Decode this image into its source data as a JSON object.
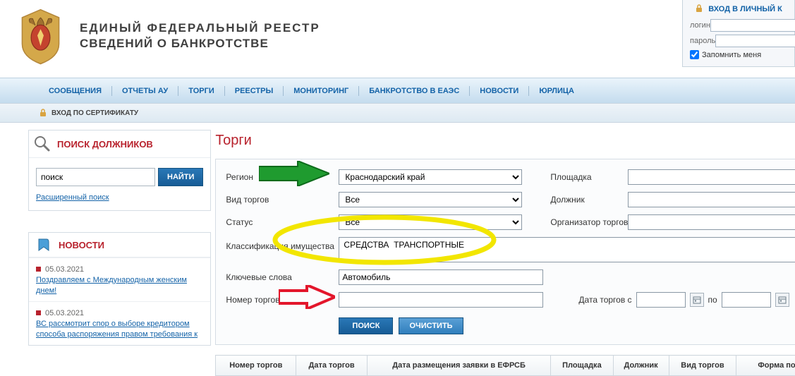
{
  "header": {
    "title_line1": "ЕДИНЫЙ  ФЕДЕРАЛЬНЫЙ  РЕЕСТР",
    "title_line2": "СВЕДЕНИЙ О БАНКРОТСТВЕ"
  },
  "login": {
    "panel_title": "ВХОД В ЛИЧНЫЙ К",
    "login_label": "логин",
    "password_label": "пароль",
    "remember_label": "Запомнить меня"
  },
  "nav": {
    "items": [
      "СООБЩЕНИЯ",
      "ОТЧЕТЫ АУ",
      "ТОРГИ",
      "РЕЕСТРЫ",
      "МОНИТОРИНГ",
      "БАНКРОТСТВО В ЕАЭС",
      "НОВОСТИ",
      "ЮРЛИЦА"
    ]
  },
  "cert": {
    "label": "ВХОД ПО СЕРТИФИКАТУ"
  },
  "debtor_search": {
    "heading": "ПОИСК ДОЛЖНИКОВ",
    "input_value": "поиск",
    "button_label": "НАЙТИ",
    "extended_link": "Расширенный поиск"
  },
  "news_block": {
    "heading": "НОВОСТИ",
    "items": [
      {
        "date": "05.03.2021",
        "title": "Поздравляем с Международным женским днем!"
      },
      {
        "date": "05.03.2021",
        "title": "ВС рассмотрит спор о выборе кредитором способа распоряжения правом требования к"
      }
    ]
  },
  "torgi": {
    "page_title": "Торги",
    "labels": {
      "region": "Регион",
      "type": "Вид торгов",
      "status": "Статус",
      "classification": "Классификация имущества",
      "keywords": "Ключевые слова",
      "number": "Номер торгов",
      "platform": "Площадка",
      "debtor": "Должник",
      "organizer": "Организатор торгов",
      "date_from": "Дата торгов  с",
      "date_to": "по"
    },
    "values": {
      "region": "Краснодарский край",
      "type": "Все",
      "status": "Все",
      "classification": "СРЕДСТВА  ТРАНСПОРТНЫЕ",
      "keywords": "Автомобиль",
      "number": "",
      "platform": "",
      "debtor": "",
      "organizer": "",
      "date_from": "",
      "date_to": ""
    },
    "buttons": {
      "search": "ПОИСК",
      "clear": "ОЧИСТИТЬ"
    },
    "table_headers": [
      "Номер торгов",
      "Дата торгов",
      "Дата размещения заявки в ЕФРСБ",
      "Площадка",
      "Должник",
      "Вид торгов",
      "Форма по предложени цене"
    ]
  }
}
